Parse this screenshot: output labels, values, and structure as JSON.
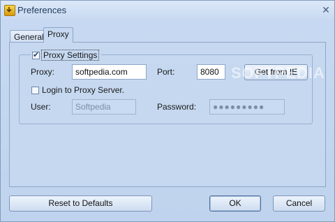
{
  "window": {
    "title": "Preferences",
    "close_glyph": "✕"
  },
  "tabs": [
    {
      "label": "General",
      "active": false
    },
    {
      "label": "Proxy",
      "active": true
    }
  ],
  "proxy": {
    "settings_label": "Proxy Settings",
    "settings_checked": true,
    "proxy_label": "Proxy:",
    "proxy_value": "softpedia.com",
    "port_label": "Port:",
    "port_value": "8080",
    "get_from_ie_label": "Get from IE",
    "login_label": "Login to Proxy Server.",
    "login_checked": false,
    "user_label": "User:",
    "user_value": "Softpedia",
    "password_label": "Password:",
    "password_value": "●●●●●●●●●"
  },
  "footer": {
    "reset_label": "Reset to Defaults",
    "ok_label": "OK",
    "cancel_label": "Cancel"
  },
  "watermark": "SOFTPEDIA",
  "colors": {
    "window_bg": "#c3d6ef",
    "title_text": "#1e395b",
    "border": "#8da5c6"
  }
}
